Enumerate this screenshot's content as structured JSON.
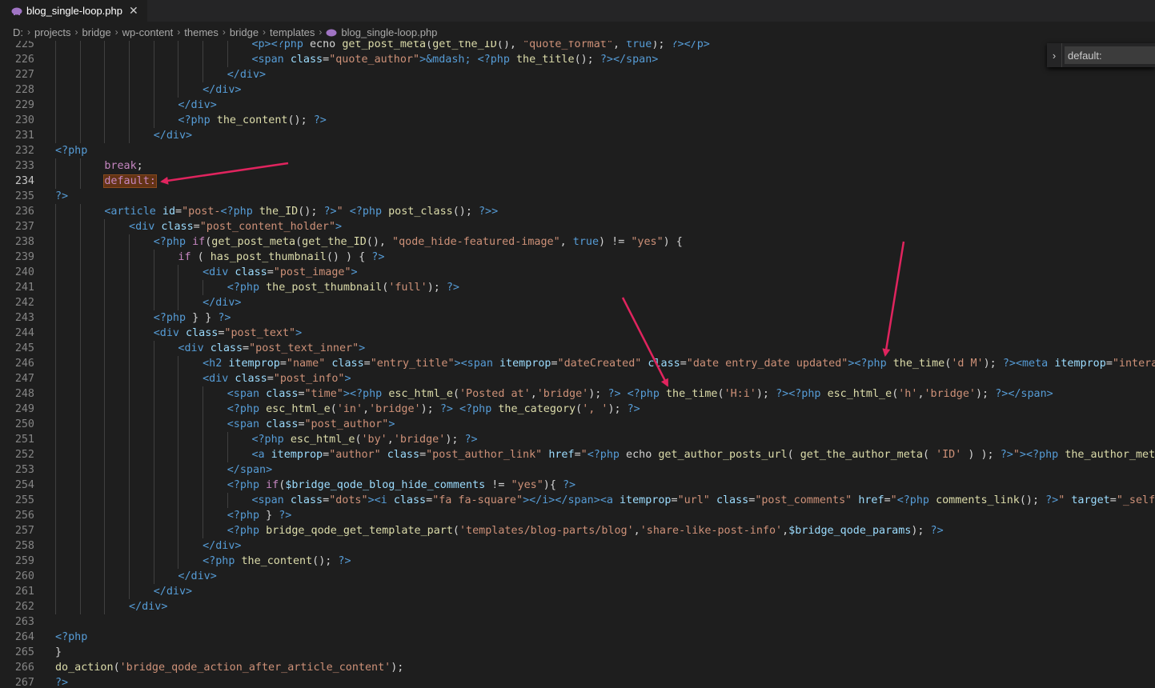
{
  "tab": {
    "filename": "blog_single-loop.php",
    "close_glyph": "✕",
    "icon": "php-elephant-icon"
  },
  "breadcrumb": [
    "D:",
    "projects",
    "bridge",
    "wp-content",
    "themes",
    "bridge",
    "templates",
    "blog_single-loop.php"
  ],
  "find": {
    "toggle_glyph": "›",
    "value": "default:"
  },
  "editor": {
    "current_line": 234,
    "highlight_color": "#623315",
    "lines": [
      {
        "n": 225,
        "i": 8,
        "c": "[[t|<p>]][[t|<?php]] echo [[f|get_post_meta]]([[f|get_the_ID]](), [[s|\"quote_format\"]], [[t|true]]); [[t|?>]][[t|</p>]]"
      },
      {
        "n": 226,
        "i": 8,
        "c": "[[t|<span]] [[a|class]]=[[s|\"quote_author\"]][[t|>]][[t|&mdash;]] [[t|<?php]] [[f|the_title]](); [[t|?>]][[t|</span>]]"
      },
      {
        "n": 227,
        "i": 7,
        "c": "[[t|</div>]]"
      },
      {
        "n": 228,
        "i": 6,
        "c": "[[t|</div>]]"
      },
      {
        "n": 229,
        "i": 5,
        "c": "[[t|</div>]]"
      },
      {
        "n": 230,
        "i": 5,
        "c": "[[t|<?php]] [[f|the_content]](); [[t|?>]]"
      },
      {
        "n": 231,
        "i": 4,
        "c": "[[t|</div>]]"
      },
      {
        "n": 232,
        "i": 0,
        "c": "[[t|<?php]]"
      },
      {
        "n": 233,
        "i": 2,
        "c": "[[k|break]];"
      },
      {
        "n": 234,
        "i": 2,
        "c": "[[hl|default:]]"
      },
      {
        "n": 235,
        "i": 0,
        "c": "[[t|?>]]"
      },
      {
        "n": 236,
        "i": 2,
        "c": "[[t|<article]] [[a|id]]=[[s|\"post-]][[t|<?php]] [[f|the_ID]](); [[t|?>]][[s|\"]] [[t|<?php]] [[f|post_class]](); [[t|?>]][[t|>]]"
      },
      {
        "n": 237,
        "i": 3,
        "c": "[[t|<div]] [[a|class]]=[[s|\"post_content_holder\"]][[t|>]]"
      },
      {
        "n": 238,
        "i": 4,
        "c": "[[t|<?php]] [[k|if]]([[f|get_post_meta]]([[f|get_the_ID]](), [[s|\"qode_hide-featured-image\"]], [[t|true]]) != [[s|\"yes\"]]) {"
      },
      {
        "n": 239,
        "i": 5,
        "c": "[[k|if]] ( [[f|has_post_thumbnail]]() ) { [[t|?>]]"
      },
      {
        "n": 240,
        "i": 6,
        "c": "[[t|<div]] [[a|class]]=[[s|\"post_image\"]][[t|>]]"
      },
      {
        "n": 241,
        "i": 7,
        "c": "[[t|<?php]] [[f|the_post_thumbnail]]([[s|'full']]); [[t|?>]]"
      },
      {
        "n": 242,
        "i": 6,
        "c": "[[t|</div>]]"
      },
      {
        "n": 243,
        "i": 4,
        "c": "[[t|<?php]] } } [[t|?>]]"
      },
      {
        "n": 244,
        "i": 4,
        "c": "[[t|<div]] [[a|class]]=[[s|\"post_text\"]][[t|>]]"
      },
      {
        "n": 245,
        "i": 5,
        "c": "[[t|<div]] [[a|class]]=[[s|\"post_text_inner\"]][[t|>]]"
      },
      {
        "n": 246,
        "i": 6,
        "c": "[[t|<h2]] [[a|itemprop]]=[[s|\"name\"]] [[a|class]]=[[s|\"entry_title\"]][[t|>]][[t|<span]] [[a|itemprop]]=[[s|\"dateCreated\"]] [[a|class]]=[[s|\"date entry_date updated\"]][[t|>]][[t|<?php]] [[f|the_time]]([[s|'d M']]); [[t|?>]][[t|<meta]] [[a|itemprop]]=[[s|\"interactionCount\"]]"
      },
      {
        "n": 247,
        "i": 6,
        "c": "[[t|<div]] [[a|class]]=[[s|\"post_info\"]][[t|>]]"
      },
      {
        "n": 248,
        "i": 7,
        "c": "[[t|<span]] [[a|class]]=[[s|\"time\"]][[t|>]][[t|<?php]] [[f|esc_html_e]]([[s|'Posted at']],[[s|'bridge']]); [[t|?>]] [[t|<?php]] [[f|the_time]]([[s|'H:i']]); [[t|?>]][[t|<?php]] [[f|esc_html_e]]([[s|'h']],[[s|'bridge']]); [[t|?>]][[t|</span>]]"
      },
      {
        "n": 249,
        "i": 7,
        "c": "[[t|<?php]] [[f|esc_html_e]]([[s|'in']],[[s|'bridge']]); [[t|?>]] [[t|<?php]] [[f|the_category]]([[s|', ']]); [[t|?>]]"
      },
      {
        "n": 250,
        "i": 7,
        "c": "[[t|<span]] [[a|class]]=[[s|\"post_author\"]][[t|>]]"
      },
      {
        "n": 251,
        "i": 8,
        "c": "[[t|<?php]] [[f|esc_html_e]]([[s|'by']],[[s|'bridge']]); [[t|?>]]"
      },
      {
        "n": 252,
        "i": 8,
        "c": "[[t|<a]] [[a|itemprop]]=[[s|\"author\"]] [[a|class]]=[[s|\"post_author_link\"]] [[a|href]]=[[s|\"]][[t|<?php]] echo [[f|get_author_posts_url]]( [[f|get_the_author_meta]]( [[s|'ID']] ) ); [[t|?>]][[s|\"]][[t|>]][[t|<?php]] [[f|the_author_meta]]([[s|'display_name']]); [[t|?>]][[t|</a>]]"
      },
      {
        "n": 253,
        "i": 7,
        "c": "[[t|</span>]]"
      },
      {
        "n": 254,
        "i": 7,
        "c": "[[t|<?php]] [[k|if]]([[v|$bridge_qode_blog_hide_comments]] != [[s|\"yes\"]]){ [[t|?>]]"
      },
      {
        "n": 255,
        "i": 8,
        "c": "[[t|<span]] [[a|class]]=[[s|\"dots\"]][[t|>]][[t|<i]] [[a|class]]=[[s|\"fa fa-square\"]][[t|>]][[t|</i>]][[t|</span>]][[t|<a]] [[a|itemprop]]=[[s|\"url\"]] [[a|class]]=[[s|\"post_comments\"]] [[a|href]]=[[s|\"]][[t|<?php]] [[f|comments_link]](); [[t|?>]][[s|\"]] [[a|target]]=[[s|\"_self\"]][[t|>]][[t|<?php]]"
      },
      {
        "n": 256,
        "i": 7,
        "c": "[[t|<?php]] } [[t|?>]]"
      },
      {
        "n": 257,
        "i": 7,
        "c": "[[t|<?php]] [[f|bridge_qode_get_template_part]]([[s|'templates/blog-parts/blog']],[[s|'share-like-post-info']],[[v|$bridge_qode_params]]); [[t|?>]]"
      },
      {
        "n": 258,
        "i": 6,
        "c": "[[t|</div>]]"
      },
      {
        "n": 259,
        "i": 6,
        "c": "[[t|<?php]] [[f|the_content]](); [[t|?>]]"
      },
      {
        "n": 260,
        "i": 5,
        "c": "[[t|</div>]]"
      },
      {
        "n": 261,
        "i": 4,
        "c": "[[t|</div>]]"
      },
      {
        "n": 262,
        "i": 3,
        "c": "[[t|</div>]]"
      },
      {
        "n": 263,
        "i": 0,
        "c": ""
      },
      {
        "n": 264,
        "i": 0,
        "c": "[[t|<?php]]"
      },
      {
        "n": 265,
        "i": 0,
        "c": "}"
      },
      {
        "n": 266,
        "i": 0,
        "c": "[[f|do_action]]([[s|'bridge_qode_action_after_article_content']]);"
      },
      {
        "n": 267,
        "i": 0,
        "c": "[[t|?>]]"
      }
    ]
  },
  "annotations": {
    "arrow_color": "#e0245e"
  }
}
